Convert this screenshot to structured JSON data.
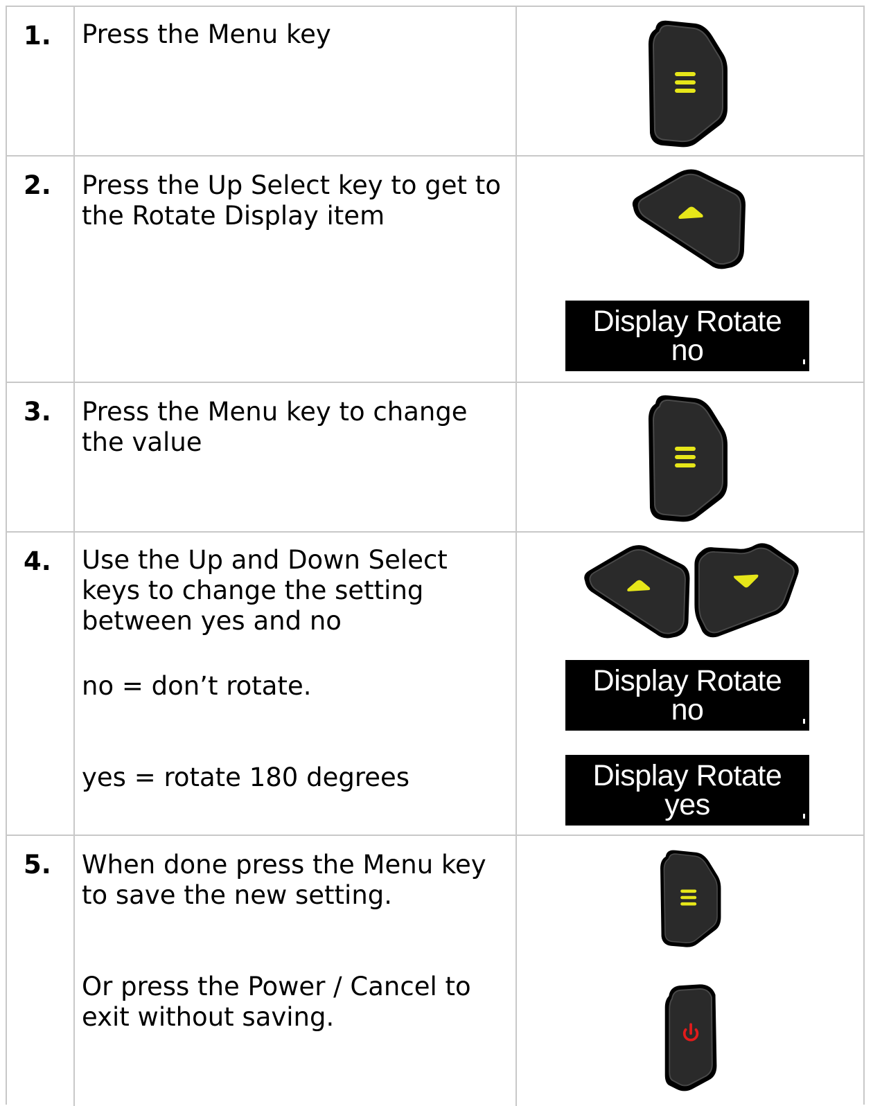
{
  "steps": [
    {
      "number": "1.",
      "lines": [
        "Press the Menu key"
      ],
      "keys": [
        "menu-key"
      ]
    },
    {
      "number": "2.",
      "lines": [
        "Press the Up Select key to get to the Rotate Display item"
      ],
      "keys": [
        "up-select-key"
      ],
      "displays": [
        {
          "line1": "Display Rotate",
          "line2": "no"
        }
      ]
    },
    {
      "number": "3.",
      "lines": [
        "Press the Menu key to change the value"
      ],
      "keys": [
        "menu-key"
      ]
    },
    {
      "number": "4.",
      "lines": [
        "Use the Up and Down Select keys to change the setting between yes and no",
        "no = don’t rotate.",
        "yes = rotate 180 degrees"
      ],
      "keys": [
        "up-select-key",
        "down-select-key"
      ],
      "displays": [
        {
          "line1": "Display Rotate",
          "line2": "no"
        },
        {
          "line1": "Display Rotate",
          "line2": "yes"
        }
      ]
    },
    {
      "number": "5.",
      "lines": [
        "When done press the Menu key to save the new setting.",
        "Or press the Power / Cancel to exit without saving."
      ],
      "keys": [
        "menu-key",
        "power-cancel-key"
      ]
    }
  ],
  "colors": {
    "key_body": "#1e1e1e",
    "key_rim": "#3a3a3a",
    "menu_glyph": "#e6e619",
    "arrow_glyph": "#e6e619",
    "power_glyph": "#e21b1b",
    "grid": "#c8c8c8"
  }
}
